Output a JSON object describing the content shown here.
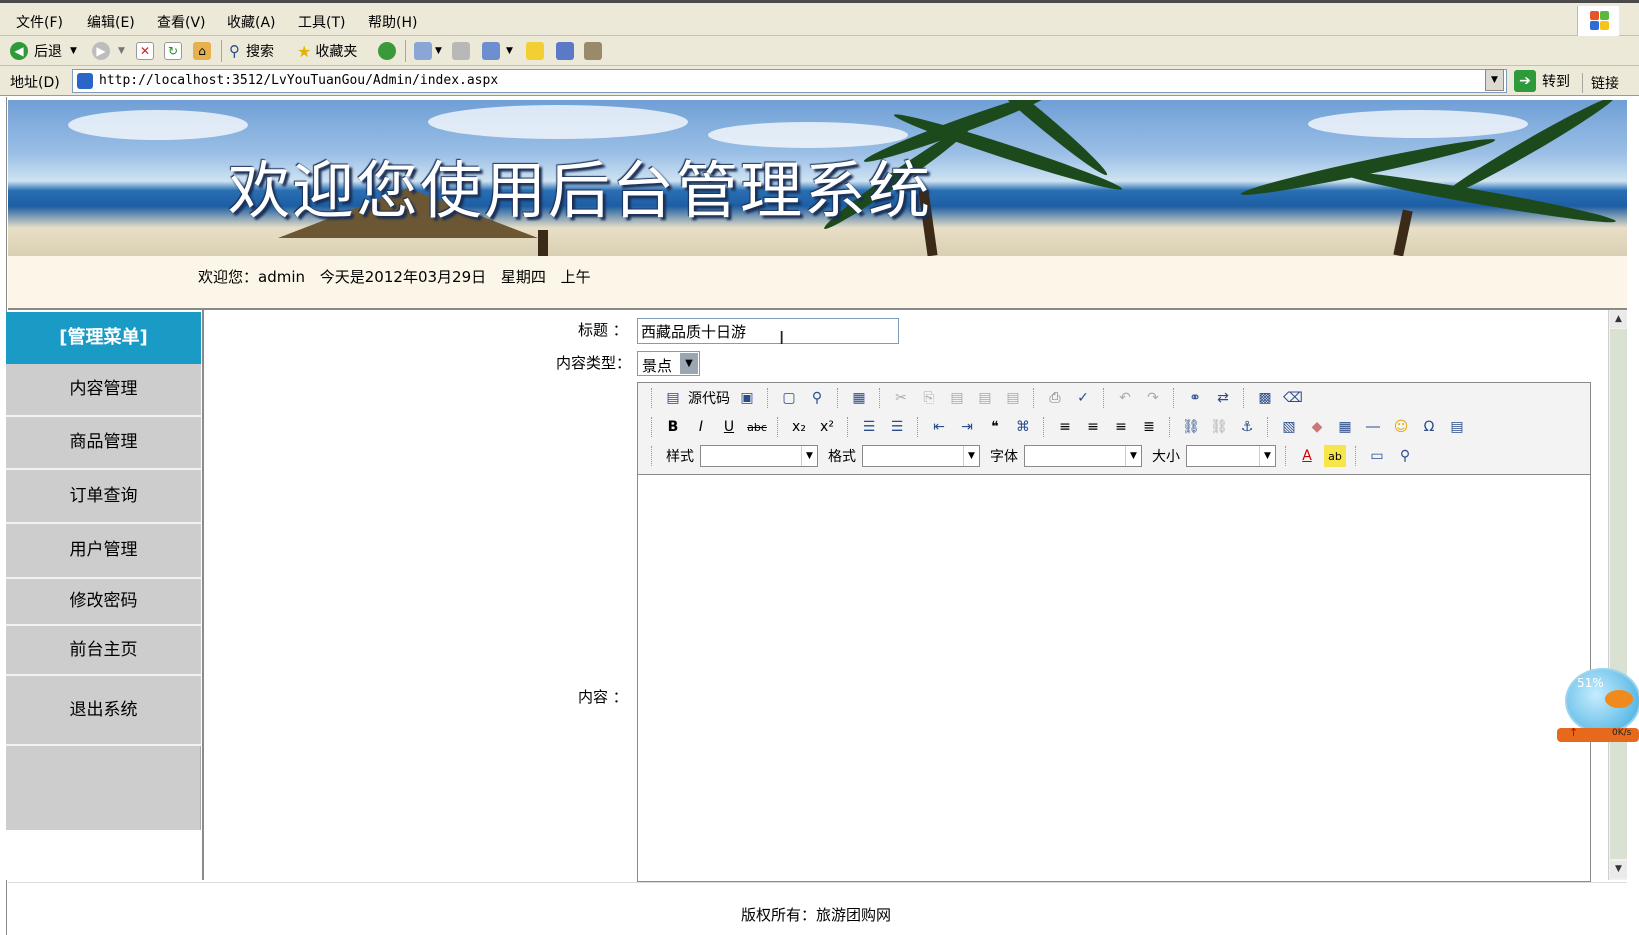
{
  "browser": {
    "menu": [
      "文件(F)",
      "编辑(E)",
      "查看(V)",
      "收藏(A)",
      "工具(T)",
      "帮助(H)"
    ],
    "toolbar": {
      "back_label": "后退",
      "search_label": "搜索",
      "favorites_label": "收藏夹"
    },
    "address": {
      "label": "地址(D)",
      "url": "http://localhost:3512/LvYouTuanGou/Admin/index.aspx",
      "go_label": "转到",
      "links_label": "链接"
    }
  },
  "page": {
    "banner_title": "欢迎您使用后台管理系统",
    "welcome_text": "欢迎您：admin  今天是2012年03月29日  星期四  上午",
    "sidebar": {
      "header": "[管理菜单]",
      "items": [
        "内容管理",
        "商品管理",
        "订单查询",
        "用户管理",
        "修改密码",
        "前台主页",
        "退出系统"
      ]
    },
    "form": {
      "title_label": "标题 ：",
      "title_value": "西藏品质十日游",
      "type_label": "内容类型：",
      "type_value": "景点",
      "content_label": "内容 ："
    },
    "editor": {
      "source_label": "源代码",
      "style_label": "样式",
      "format_label": "格式",
      "font_label": "字体",
      "size_label": "大小"
    },
    "footer": "版权所有：旅游团购网"
  },
  "net_widget": {
    "percent": "51%",
    "speed": "0K/s"
  },
  "colors": {
    "chrome": "#ece9d8",
    "menu_header": "#1a9bc5",
    "sidebar": "#cdcdcd",
    "welcome_bg": "#fbf6e7"
  }
}
